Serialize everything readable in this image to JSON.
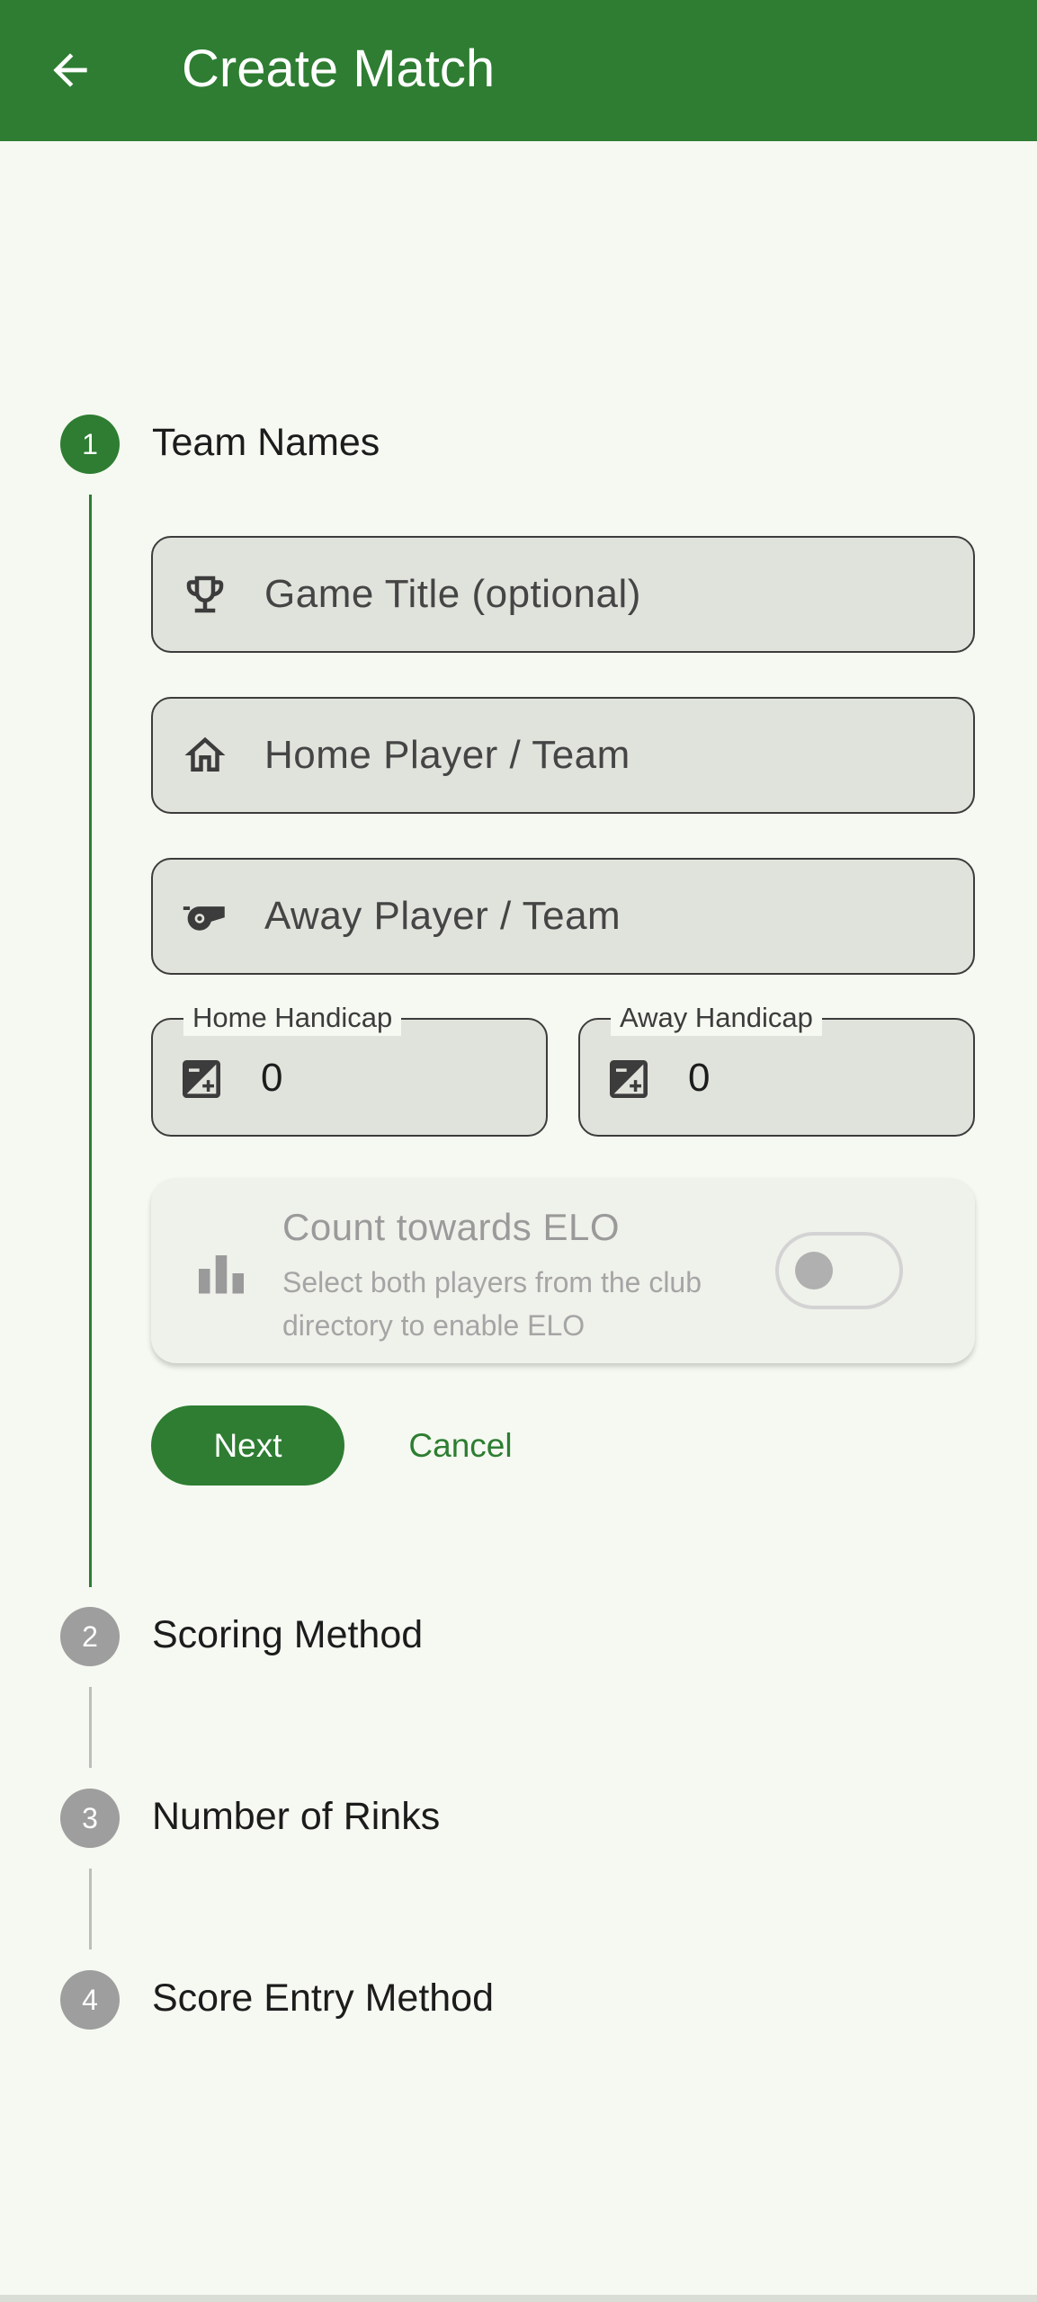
{
  "appbar": {
    "title": "Create Match",
    "back_icon": "arrow-back-icon",
    "color": "#2E7D32"
  },
  "steps": [
    {
      "number": "1",
      "title": "Team Names",
      "state": "active"
    },
    {
      "number": "2",
      "title": "Scoring Method",
      "state": "inactive"
    },
    {
      "number": "3",
      "title": "Number of Rinks",
      "state": "inactive"
    },
    {
      "number": "4",
      "title": "Score Entry Method",
      "state": "inactive"
    }
  ],
  "form": {
    "game_title": {
      "placeholder": "Game Title (optional)",
      "icon": "trophy-icon"
    },
    "home_team": {
      "placeholder": "Home Player / Team",
      "icon": "home-icon"
    },
    "away_team": {
      "placeholder": "Away Player / Team",
      "icon": "whistle-icon"
    },
    "home_handicap": {
      "label": "Home Handicap",
      "value": "0",
      "icon": "exposure-icon"
    },
    "away_handicap": {
      "label": "Away Handicap",
      "value": "0",
      "icon": "exposure-icon"
    },
    "elo": {
      "title": "Count towards ELO",
      "description": "Select both players from the club directory to enable ELO",
      "icon": "leaderboard-icon",
      "enabled": false
    }
  },
  "actions": {
    "next_label": "Next",
    "cancel_label": "Cancel"
  }
}
